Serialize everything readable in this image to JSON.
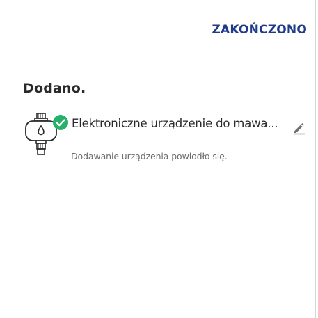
{
  "header": {
    "finish_label": "ZAKOŃCZONO"
  },
  "main": {
    "heading": "Dodano.",
    "device": {
      "name": "Elektroniczne urządzenie do mawa...",
      "status": "Dodawanie urządzenia powiodło się.",
      "icon": "water-timer-icon",
      "success_icon": "check-circle-icon",
      "edit_icon": "pencil-icon"
    }
  },
  "colors": {
    "accent": "#1e3a8a",
    "success": "#27b06a",
    "text": "#2a2a2a",
    "muted": "#6b6b6b"
  }
}
